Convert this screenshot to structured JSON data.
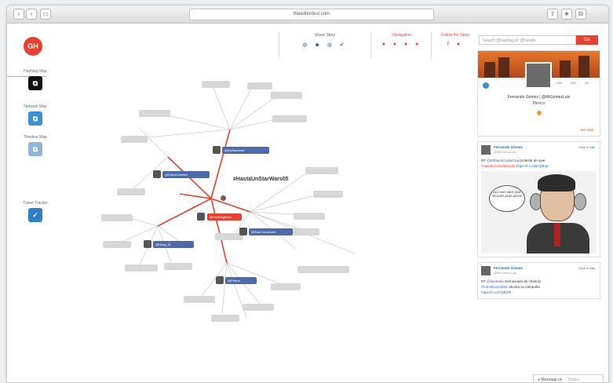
{
  "browser": {
    "url": "theeditortest.com",
    "nav_back": "‹",
    "nav_forward": "›",
    "sidebar_toggle": "▭",
    "action_share": "⇧",
    "action_bookmark": "★",
    "action_tabs": "⧉"
  },
  "app": {
    "logo_text": "GH"
  },
  "sidebar": {
    "items": [
      {
        "label": "Hashtag Map",
        "icon": "graph-icon",
        "color": "#111111",
        "glyph": "⧉"
      },
      {
        "label": "Network Map",
        "icon": "network-icon",
        "color": "#3a8fd6",
        "glyph": "⧉"
      },
      {
        "label": "Timeline Map",
        "icon": "timeline-icon",
        "color": "#8fb6d9",
        "glyph": "⧉"
      },
      {
        "label": "Tweet Tracker",
        "icon": "twitter-icon",
        "color": "#2f7ec7",
        "glyph": "✓"
      }
    ]
  },
  "header": {
    "groups": [
      {
        "label": "Share Story",
        "color": "#666666",
        "icons": [
          "◍",
          "◆",
          "◍",
          "✔"
        ]
      },
      {
        "label": "Navigation",
        "color": "#e8402f",
        "icons": [
          "●",
          "●",
          "●",
          "●"
        ]
      },
      {
        "label": "Follow the Story",
        "color": "#e8402f",
        "icons": [
          "f",
          "●"
        ]
      }
    ],
    "search_placeholder": "Search @hashtag or @handle",
    "search_button": "Go"
  },
  "graph": {
    "hashtag": "#HastaUnStarWars05",
    "center": "@HashtagBlast",
    "hubs": [
      "@EjeNacional",
      "@DianaCatedra",
      "@RaulCanciones",
      "@Hizvy_M",
      "@Petrus"
    ],
    "colors": {
      "accent": "#e8402f",
      "hub": "#4d6bab",
      "leaf": "#d7d7d7"
    }
  },
  "profile": {
    "name": "Fernando Gómez | @MrGomezLuis",
    "location": "México",
    "stats": [
      "128",
      "431",
      "18"
    ],
    "more": "Ver más"
  },
  "tweets": [
    {
      "name": "Fernando Gómez",
      "handle": "@MrGomezLuis",
      "time": "hace 3 días",
      "text_prefix": "RT",
      "text_link": "@ElDiarioCiudad",
      "text_rest": "La protesta de ayer",
      "text_hashtag": "#HastaUnStarWars05",
      "text_url": "https://t.co/aE7pBqS",
      "cartoon_text": "¡NO HAY MÁS QUE SEGUIR ADELANTE!"
    },
    {
      "name": "Fernando Gómez",
      "handle": "@MrGomezLuis",
      "time": "hace 4 días",
      "text_prefix": "RT",
      "text_link": "@Ilustrado",
      "text_rest": "Demasiado de chancla",
      "text_hashtag": "#ConstitucionMX",
      "text_rest2": "ahorita su campaña",
      "text_url": "https://t.co/zQ3bP9"
    }
  ],
  "footer": {
    "message_button": "Message us",
    "message_status": "Online"
  }
}
